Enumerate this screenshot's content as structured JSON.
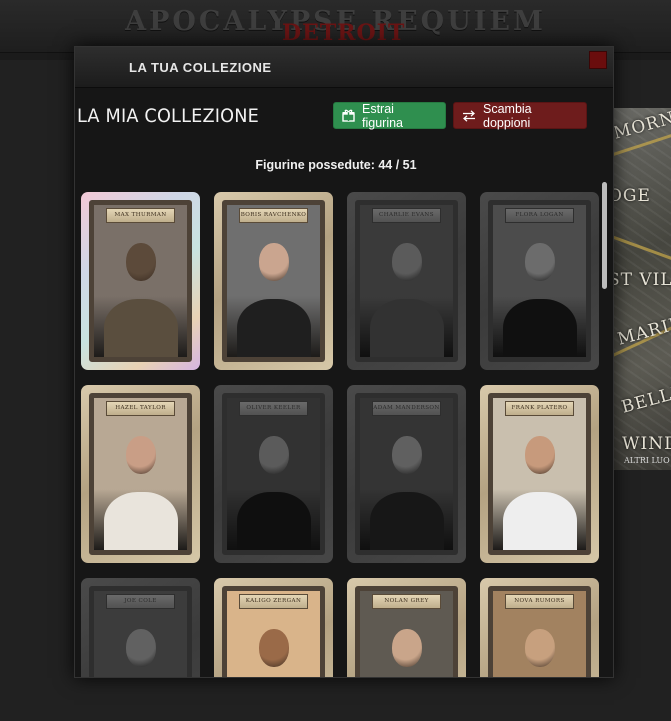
{
  "site": {
    "logo": "APOCALYPSE REQUIEM",
    "logo_sub": "DETROIT",
    "map_labels": [
      "MORN",
      "OGE",
      "ST VILL",
      "MARINA",
      "BELLE I",
      "WINDS"
    ],
    "map_sub": "ALTRI LUO"
  },
  "modal": {
    "title": "LA TUA COLLEZIONE",
    "close_icon": "close-icon"
  },
  "collection": {
    "heading": "LA MIA COLLEZIONE",
    "draw_button": {
      "label": "Estrai figurina",
      "icon": "gift-icon",
      "color": "#2f8f4f"
    },
    "swap_button": {
      "label": "Scambia doppioni",
      "icon": "swap-arrows-icon",
      "color": "#6e1c1c"
    },
    "owned_label": "Figurine possedute: 44 / 51",
    "owned": 44,
    "total": 51
  },
  "cards": [
    {
      "name": "MAX THURMAN",
      "owned": true,
      "holo": true,
      "tones": [
        "#7a7068",
        "#5c4a3a",
        "#5a4e3e"
      ]
    },
    {
      "name": "BORIS RAVCHENKO",
      "owned": true,
      "holo": false,
      "tones": [
        "#6f6f6f",
        "#caa58f",
        "#1f1f1f"
      ]
    },
    {
      "name": "CHARLIE EVANS",
      "owned": false,
      "holo": false,
      "tones": [
        "#6a6a6a",
        "#b9a28f",
        "#5a5a5a"
      ]
    },
    {
      "name": "FLORA LOGAN",
      "owned": false,
      "holo": false,
      "tones": [
        "#8a8a8a",
        "#d6c1b3",
        "#1e1e1e"
      ]
    },
    {
      "name": "HAZEL TAYLOR",
      "owned": true,
      "holo": false,
      "tones": [
        "#b8a894",
        "#c99e86",
        "#e9e4dc"
      ]
    },
    {
      "name": "OLIVER KEELER",
      "owned": false,
      "holo": false,
      "tones": [
        "#5a5a5a",
        "#b8a38f",
        "#1c1c1c"
      ]
    },
    {
      "name": "ADAM MANDERSON",
      "owned": false,
      "holo": false,
      "tones": [
        "#5e5e5e",
        "#c2ab96",
        "#2a2a2a"
      ]
    },
    {
      "name": "FRANK PLATERO",
      "owned": true,
      "holo": false,
      "tones": [
        "#c9bfae",
        "#c79a7c",
        "#eeeeee"
      ]
    },
    {
      "name": "JOE COLE",
      "owned": false,
      "holo": false,
      "tones": [
        "#6d6d6d",
        "#c4ad98",
        "#7a7a7a"
      ]
    },
    {
      "name": "KALIGO ZERGAN",
      "owned": true,
      "holo": false,
      "tones": [
        "#d9b48a",
        "#9a6a48",
        "#7a5a3e"
      ]
    },
    {
      "name": "NOLAN GREY",
      "owned": true,
      "holo": false,
      "tones": [
        "#5f5a52",
        "#c9a58a",
        "#2e2a26"
      ]
    },
    {
      "name": "NOVA RUMORS",
      "owned": true,
      "holo": false,
      "tones": [
        "#a28260",
        "#c7a07e",
        "#7b5a3c"
      ]
    }
  ]
}
